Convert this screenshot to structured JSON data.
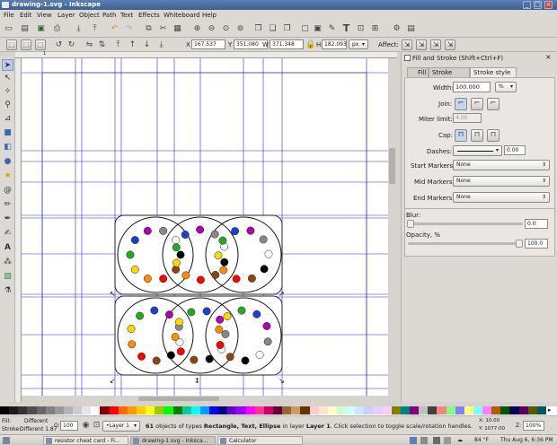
{
  "window": {
    "title": "drawing-1.svg - Inkscape",
    "buttons": [
      "_",
      "□",
      "×"
    ]
  },
  "menubar": [
    "File",
    "Edit",
    "View",
    "Layer",
    "Object",
    "Path",
    "Text",
    "Effects",
    "Whiteboard",
    "Help"
  ],
  "controls": {
    "x_label": "X",
    "x_value": "167.537",
    "y_label": "Y",
    "y_value": "351.080",
    "w_label": "W",
    "w_value": "371.348",
    "h_label": "H",
    "h_value": "182.093",
    "unit": "px",
    "affect_label": "Affect:"
  },
  "panel": {
    "title": "Fill and Stroke (Shift+Ctrl+F)",
    "tabs": [
      "Fill",
      "Stroke paint",
      "Stroke style"
    ],
    "active_tab": "Stroke style",
    "width_label": "Width:",
    "width_value": "100.000",
    "width_unit": "%",
    "join_label": "Join:",
    "miter_label": "Miter limit:",
    "miter_value": "4.00",
    "cap_label": "Cap:",
    "dashes_label": "Dashes:",
    "dashes_value": "0.00",
    "start_markers_label": "Start Markers:",
    "start_markers_value": "None",
    "mid_markers_label": "Mid Markers:",
    "mid_markers_value": "None",
    "end_markers_label": "End Markers:",
    "end_markers_value": "None",
    "blur_label": "Blur:",
    "blur_value": "0.0",
    "opacity_label": "Opacity, %",
    "opacity_value": "100.0",
    "opacity_level": 1.0
  },
  "statusbar": {
    "fill_label": "Fill:",
    "fill_value": "Different",
    "stroke_label": "Stroke:",
    "stroke_value": "Different 1.87",
    "o_label": "O:",
    "o_value": "100",
    "layer": "•Layer 1",
    "message_count": "61",
    "message_pre": " objects of types ",
    "message_types": "Rectangle, Text, Ellipse",
    "message_mid": " in layer ",
    "message_layer": "Layer 1",
    "message_post": ". Click selection to toggle scale/rotation handles.",
    "x_coord": "X: 10.00",
    "y_coord": "Y: 1077.00",
    "z_label": "Z:",
    "zoom": "100%"
  },
  "taskbar": {
    "items": [
      "resistor cheat card - Fi...",
      "drawing-1.svg - Inksca...",
      "Calculator"
    ],
    "active_index": 1,
    "weather": "84 °F",
    "clock": "Thu Aug 6,  6:36 PM"
  },
  "ruler_labels": [
    "1"
  ],
  "colors": {
    "guide": "#2a2ad8",
    "titlebar": "#4a6ea0",
    "selection": "#2f2fb8"
  },
  "palette": [
    "#000000",
    "#1a1a1a",
    "#333333",
    "#4d4d4d",
    "#666666",
    "#808080",
    "#999999",
    "#b3b3b3",
    "#cccccc",
    "#e6e6e6",
    "#ffffff",
    "#800000",
    "#ff0000",
    "#ff6600",
    "#ff9900",
    "#ffcc00",
    "#ffff00",
    "#99cc00",
    "#00ff00",
    "#008000",
    "#00cc99",
    "#00ffff",
    "#0099ff",
    "#0000ff",
    "#000080",
    "#6600cc",
    "#9900ff",
    "#ff00ff",
    "#ff3399",
    "#cc0066",
    "#660033",
    "#996633",
    "#cc9966",
    "#663300",
    "#ffcccc",
    "#ffe6cc",
    "#ffffcc",
    "#ccffcc",
    "#ccffff",
    "#cce6ff",
    "#ccccff",
    "#e6ccff",
    "#ffccff",
    "#808000",
    "#008080",
    "#800080",
    "#c0c0c0",
    "#404040",
    "#ff8080",
    "#80ff80",
    "#8080ff",
    "#ffff80",
    "#80ffff",
    "#ff80ff",
    "#b35900",
    "#005900",
    "#000059",
    "#590059",
    "#595900",
    "#005959"
  ]
}
